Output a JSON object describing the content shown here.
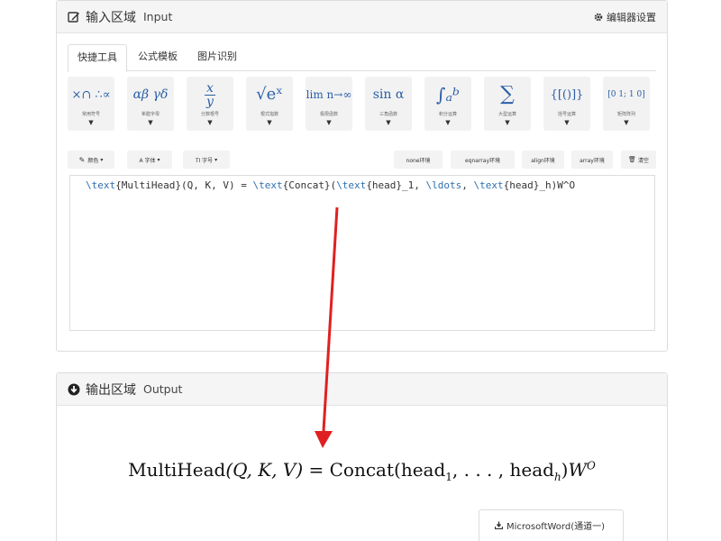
{
  "input_panel": {
    "title": "输入区域",
    "title_en": "Input",
    "settings_label": "编辑器设置",
    "tabs": [
      {
        "label": "快捷工具",
        "active": true
      },
      {
        "label": "公式模板",
        "active": false
      },
      {
        "label": "图片识别",
        "active": false
      }
    ],
    "tools": [
      {
        "glyph": "×∩ ∴∝",
        "caption": "常用符号"
      },
      {
        "glyph": "αβ γδ",
        "caption": "希腊字母"
      },
      {
        "glyph_num": "x",
        "glyph_den": "y",
        "caption": "分数根号"
      },
      {
        "glyph": "√eˣ",
        "caption": "根式指数"
      },
      {
        "glyph": "lim n→∞",
        "caption": "极限函数"
      },
      {
        "glyph": "sin α",
        "caption": "三角函数"
      },
      {
        "glyph": "∫ₐᵇ",
        "caption": "积分运算"
      },
      {
        "glyph": "∑",
        "caption": "大型运算"
      },
      {
        "glyph": "{[()]}",
        "caption": "括号运算"
      },
      {
        "glyph": "[0 1; 1 0]",
        "caption": "矩阵阵列"
      }
    ],
    "toolbar": {
      "color": "颜色",
      "font": "A 字体",
      "size": "TI 字号",
      "none_env": "none环境",
      "eqnarray_env": "eqnarray环境",
      "align_env": "align环境",
      "array_env": "array环境",
      "clear": "清空"
    },
    "editor_segments": [
      "\\text",
      "{MultiHead}(Q, K, V) = ",
      "\\text",
      "{Concat}(",
      "\\text",
      "{head}_1, ",
      "\\ldots",
      ", ",
      "\\text",
      "{head}_h)W^O"
    ]
  },
  "output_panel": {
    "title": "输出区域",
    "title_en": "Output",
    "formula": {
      "lhs": "MultiHead",
      "args": "(Q, K, V)",
      "eq": " = ",
      "concat": "Concat(head",
      "sub1": "1",
      "dots": ", . . . , head",
      "subh": "h",
      "close": ")",
      "w": "W",
      "sup": "O"
    },
    "download_label": "MicrosoftWord(通道一)"
  },
  "colors": {
    "accent_blue": "#2a5ea8",
    "arrow_red": "#e02020",
    "panel_header": "#f5f5f5"
  }
}
